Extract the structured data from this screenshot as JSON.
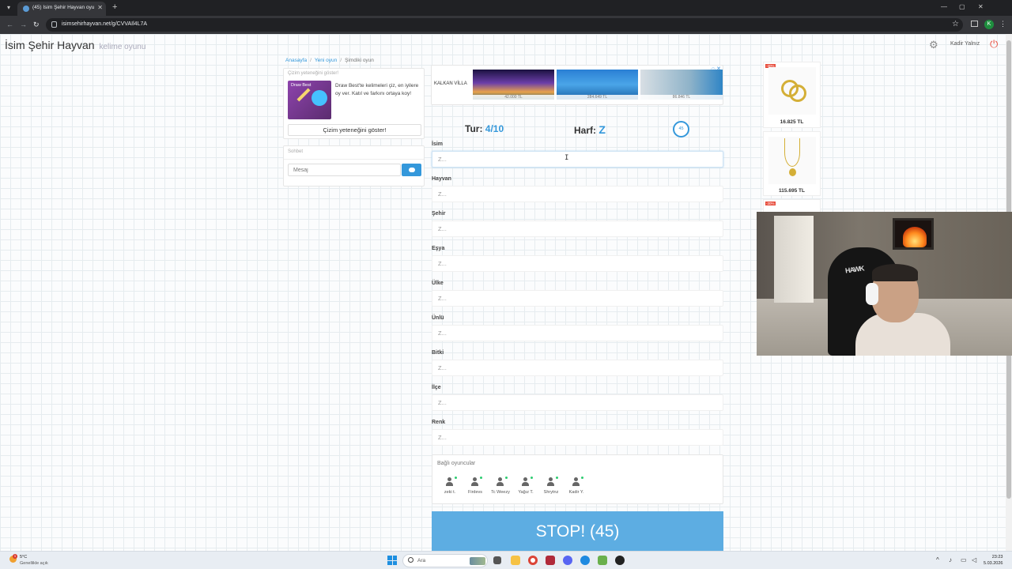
{
  "browser": {
    "tab_title": "(45) İsim Şehir Hayvan oyunu",
    "url": "isimsehirhayvan.net/g/CVVAIl4L7A",
    "profile_initial": "K"
  },
  "header": {
    "brand": "İsim Şehir Hayvan",
    "brand_sub": "kelime oyunu",
    "username": "Kadir Yalnız"
  },
  "breadcrumb": [
    "Anasayfa",
    "Yeni oyun",
    "Şimdiki oyun"
  ],
  "draw_card": {
    "title": "Çizim yeteneğini göster!",
    "image_label": "Draw Best",
    "description": "Draw Best'te kelimeleri çiz, en iyilere oy ver. Katıl ve farkını ortaya koy!",
    "button": "Çizim yeteneğini göster!"
  },
  "chat": {
    "title": "Sohbet",
    "placeholder": "Mesaj"
  },
  "ad": {
    "logo": "KALKAN VİLLA",
    "prices": [
      "42.000 TL",
      "284.649 TL",
      "86.846 TL"
    ]
  },
  "game": {
    "round_label": "Tur:",
    "round_value": "4/10",
    "letter_label": "Harf:",
    "letter_value": "Z",
    "timer": "45"
  },
  "fields": [
    {
      "label": "İsim",
      "placeholder": "Z..."
    },
    {
      "label": "Hayvan",
      "placeholder": "Z..."
    },
    {
      "label": "Şehir",
      "placeholder": "Z..."
    },
    {
      "label": "Eşya",
      "placeholder": "Z..."
    },
    {
      "label": "Ülke",
      "placeholder": "Z..."
    },
    {
      "label": "Ünlü",
      "placeholder": "Z..."
    },
    {
      "label": "Bitki",
      "placeholder": "Z..."
    },
    {
      "label": "İlçe",
      "placeholder": "Z..."
    },
    {
      "label": "Renk",
      "placeholder": "Z..."
    }
  ],
  "players": {
    "title": "Bağlı oyuncular",
    "list": [
      "zeki t.",
      "Firdevs",
      "Tc Weezy",
      "Yağız T.",
      "Shrytnz",
      "Kadir Y."
    ]
  },
  "stop_button": "STOP! (45)",
  "products": [
    {
      "badge": "-30%",
      "price": "16.825 TL"
    },
    {
      "badge": "-30%",
      "price": "115.695 TL"
    }
  ],
  "webcam": {
    "chair_text": "HAWK"
  },
  "taskbar": {
    "temp": "5°C",
    "weather": "Genellikle açık",
    "badge": "1",
    "search": "Ara",
    "time": "23:23",
    "date": "5.03.2026"
  },
  "colors": {
    "accent": "#3498db",
    "stop": "#5dade2",
    "danger": "#e74c3c"
  }
}
